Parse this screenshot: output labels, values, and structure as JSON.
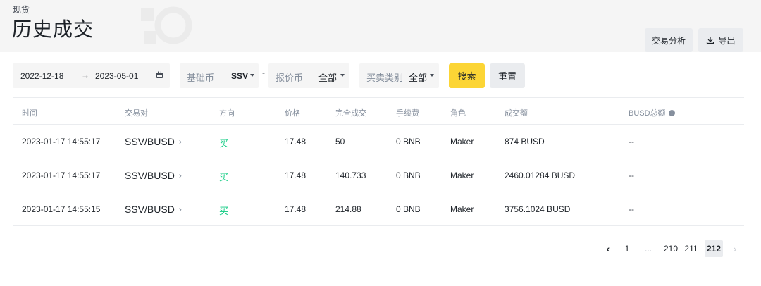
{
  "header": {
    "breadcrumb": "现货",
    "title": "历史成交",
    "analysis_label": "交易分析",
    "export_label": "导出"
  },
  "filters": {
    "start_date": "2022-12-18",
    "end_date": "2023-05-01",
    "base_label": "基础币",
    "base_value": "SSV",
    "separator": "-",
    "quote_label": "报价币",
    "quote_value": "全部",
    "side_label": "买卖类别",
    "side_value": "全部",
    "search_label": "搜索",
    "reset_label": "重置"
  },
  "table": {
    "columns": [
      "时间",
      "交易对",
      "方向",
      "价格",
      "完全成交",
      "手续费",
      "角色",
      "成交额",
      "BUSD总额"
    ],
    "rows": [
      {
        "time": "2023-01-17 14:55:17",
        "pair": "SSV/BUSD",
        "side": "买",
        "price": "17.48",
        "filled": "50",
        "fee": "0 BNB",
        "role": "Maker",
        "total": "874 BUSD",
        "busd_total": "--"
      },
      {
        "time": "2023-01-17 14:55:17",
        "pair": "SSV/BUSD",
        "side": "买",
        "price": "17.48",
        "filled": "140.733",
        "fee": "0 BNB",
        "role": "Maker",
        "total": "2460.01284 BUSD",
        "busd_total": "--"
      },
      {
        "time": "2023-01-17 14:55:15",
        "pair": "SSV/BUSD",
        "side": "买",
        "price": "17.48",
        "filled": "214.88",
        "fee": "0 BNB",
        "role": "Maker",
        "total": "3756.1024 BUSD",
        "busd_total": "--"
      }
    ]
  },
  "pagination": {
    "pages": [
      "1",
      "...",
      "210",
      "211",
      "212"
    ],
    "current": "212"
  },
  "colors": {
    "accent": "#fcd535",
    "buy": "#0ecb81",
    "header_bg": "#f5f5f5"
  }
}
